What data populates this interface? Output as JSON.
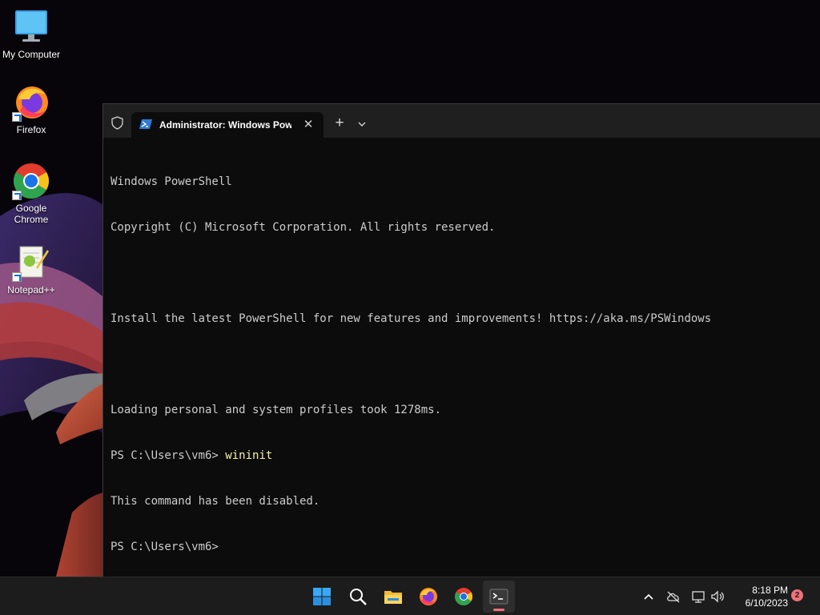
{
  "desktop": {
    "icons": [
      {
        "label": "My Computer",
        "icon": "monitor-icon"
      },
      {
        "label": "Firefox",
        "icon": "firefox-icon"
      },
      {
        "label": "Google Chrome",
        "icon": "chrome-icon"
      },
      {
        "label": "Notepad++",
        "icon": "notepadpp-icon"
      }
    ]
  },
  "terminal": {
    "tab_title": "Administrator: Windows PowerShell",
    "close_symbol": "✕",
    "new_tab_symbol": "+",
    "lines": [
      {
        "text": "Windows PowerShell"
      },
      {
        "text": "Copyright (C) Microsoft Corporation. All rights reserved."
      },
      {
        "text": ""
      },
      {
        "text": "Install the latest PowerShell for new features and improvements! https://aka.ms/PSWindows"
      },
      {
        "text": ""
      },
      {
        "text": "Loading personal and system profiles took 1278ms."
      },
      {
        "prompt": "PS C:\\Users\\vm6> ",
        "command": "wininit"
      },
      {
        "text": "This command has been disabled."
      },
      {
        "prompt": "PS C:\\Users\\vm6> ",
        "command": ""
      }
    ]
  },
  "taskbar": {
    "apps": [
      "start-icon",
      "search-icon",
      "file-explorer-icon",
      "firefox-icon",
      "chrome-icon",
      "terminal-icon"
    ],
    "clock": {
      "time": "8:18 PM",
      "date": "6/10/2023"
    },
    "notification_count": "2"
  },
  "colors": {
    "terminal_bg": "#0c0c0c",
    "titlebar_bg": "#1f1f1f",
    "text": "#cccccc",
    "command": "#f9f1a5",
    "accent": "#f0727a"
  }
}
